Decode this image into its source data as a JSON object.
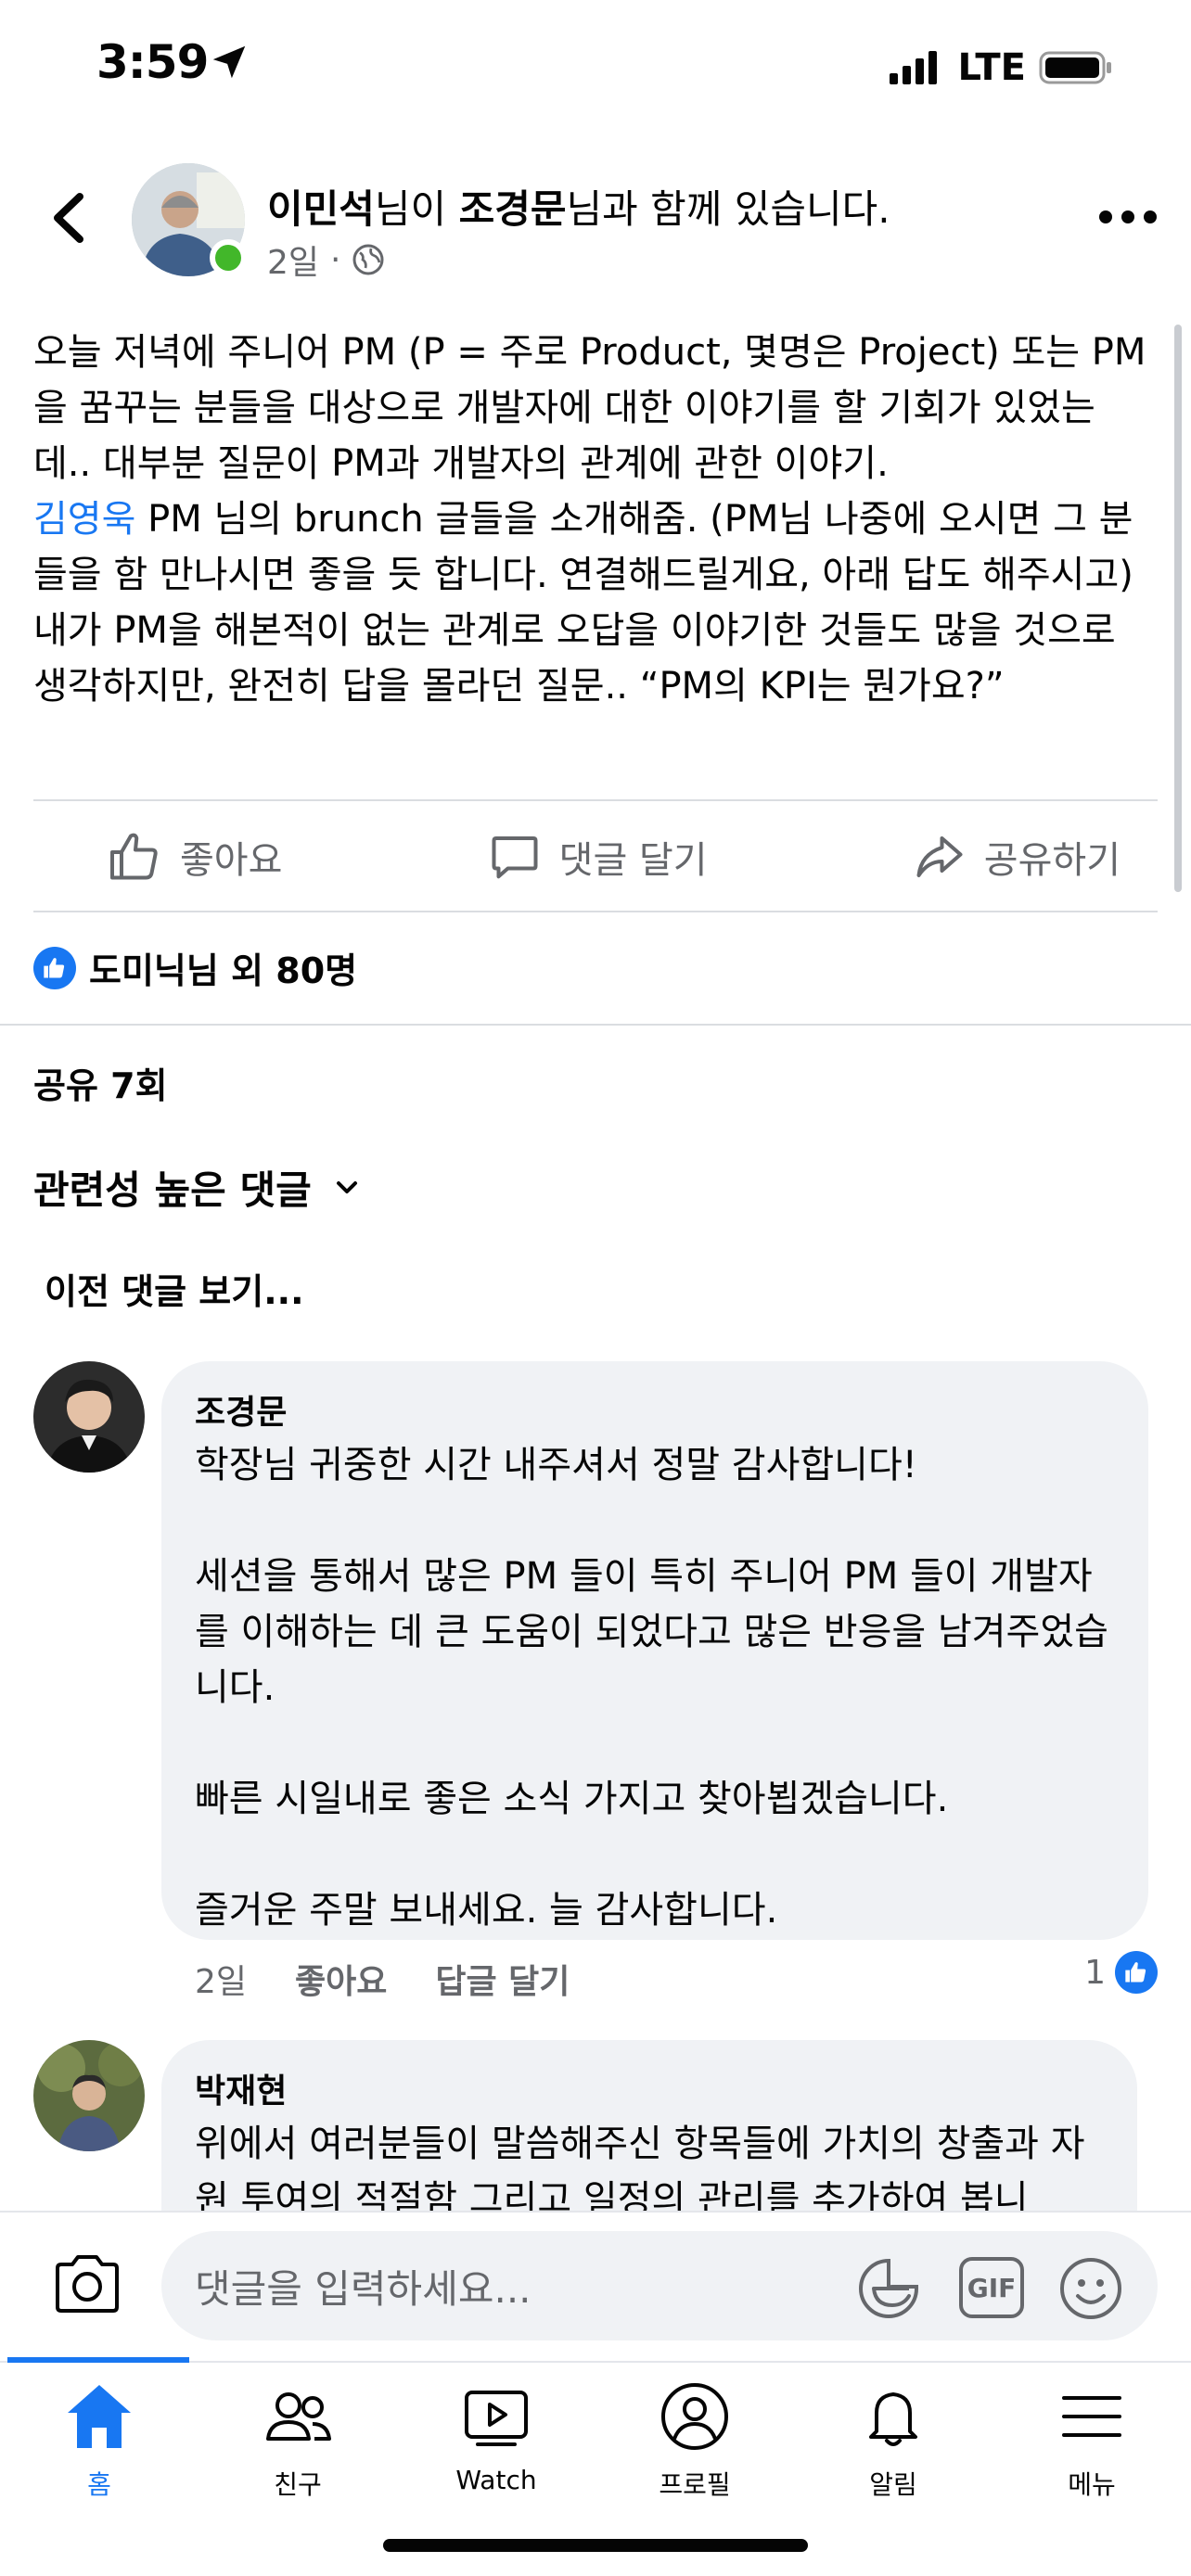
{
  "status_bar": {
    "time": "3:59",
    "network": "LTE"
  },
  "post": {
    "author": "이민석",
    "author_suffix": "님이 ",
    "tagged": "조경문",
    "tagged_suffix": "님과 함께 있습니다.",
    "time": "2일",
    "separator": "·",
    "body_line1": "오늘 저녁에 주니어 PM (P = 주로 Product, 몇명은 Project) 또는 PM을 꿈꾸는 분들을 대상으로 개발자에 대한 이야기를 할 기회가 있었는데.. 대부분 질문이 PM과 개발자의 관계에 관한 이야기.",
    "mention": "김영욱",
    "body_line2": " PM 님의 brunch 글들을 소개해줌. (PM님 나중에 오시면 그 분들을 함 만나시면 좋을 듯 합니다. 연결해드릴게요, 아래 답도 해주시고)",
    "body_line3": "내가 PM을 해본적이 없는 관계로 오답을 이야기한 것들도 많을 것으로 생각하지만, 완전히 답을 몰라던 질문..  “PM의 KPI는 뭔가요?”"
  },
  "actions": {
    "like": "좋아요",
    "comment": "댓글 달기",
    "share": "공유하기"
  },
  "reactions": {
    "summary": "도미닉님 외 80명"
  },
  "shares": "공유 7회",
  "sort_label": "관련성 높은 댓글",
  "previous_comments": "이전 댓글 보기...",
  "comments": [
    {
      "name": "조경문",
      "text": "학장님 귀중한 시간 내주셔서 정말 감사합니다!\n\n세션을 통해서 많은 PM 들이 특히 주니어 PM 들이 개발자를 이해하는 데 큰 도움이 되었다고 많은 반응을 남겨주었습니다.\n\n빠른 시일내로 좋은 소식 가지고 찾아뵙겠습니다.\n\n즐거운 주말 보내세요. 늘 감사합니다.",
      "time": "2일",
      "like": "좋아요",
      "reply": "답글 달기",
      "reaction_count": "1"
    },
    {
      "name": "박재현",
      "text": "위에서 여러분들이 말씀해주신 항목들에 가치의 창출과 자원 투여의 적절함 그리고 일정의 관리를 추가하여 봅니"
    }
  ],
  "composer": {
    "placeholder": "댓글을 입력하세요...",
    "gif": "GIF"
  },
  "tabs": [
    {
      "label": "홈",
      "icon": "home-icon",
      "active": true
    },
    {
      "label": "친구",
      "icon": "friends-icon",
      "active": false
    },
    {
      "label": "Watch",
      "icon": "watch-icon",
      "active": false
    },
    {
      "label": "프로필",
      "icon": "profile-icon",
      "active": false
    },
    {
      "label": "알림",
      "icon": "bell-icon",
      "active": false
    },
    {
      "label": "메뉴",
      "icon": "menu-icon",
      "active": false
    }
  ],
  "colors": {
    "accent": "#1877f2",
    "bubble": "#f0f2f5",
    "secondary_text": "#65676b",
    "online": "#42b72a"
  }
}
